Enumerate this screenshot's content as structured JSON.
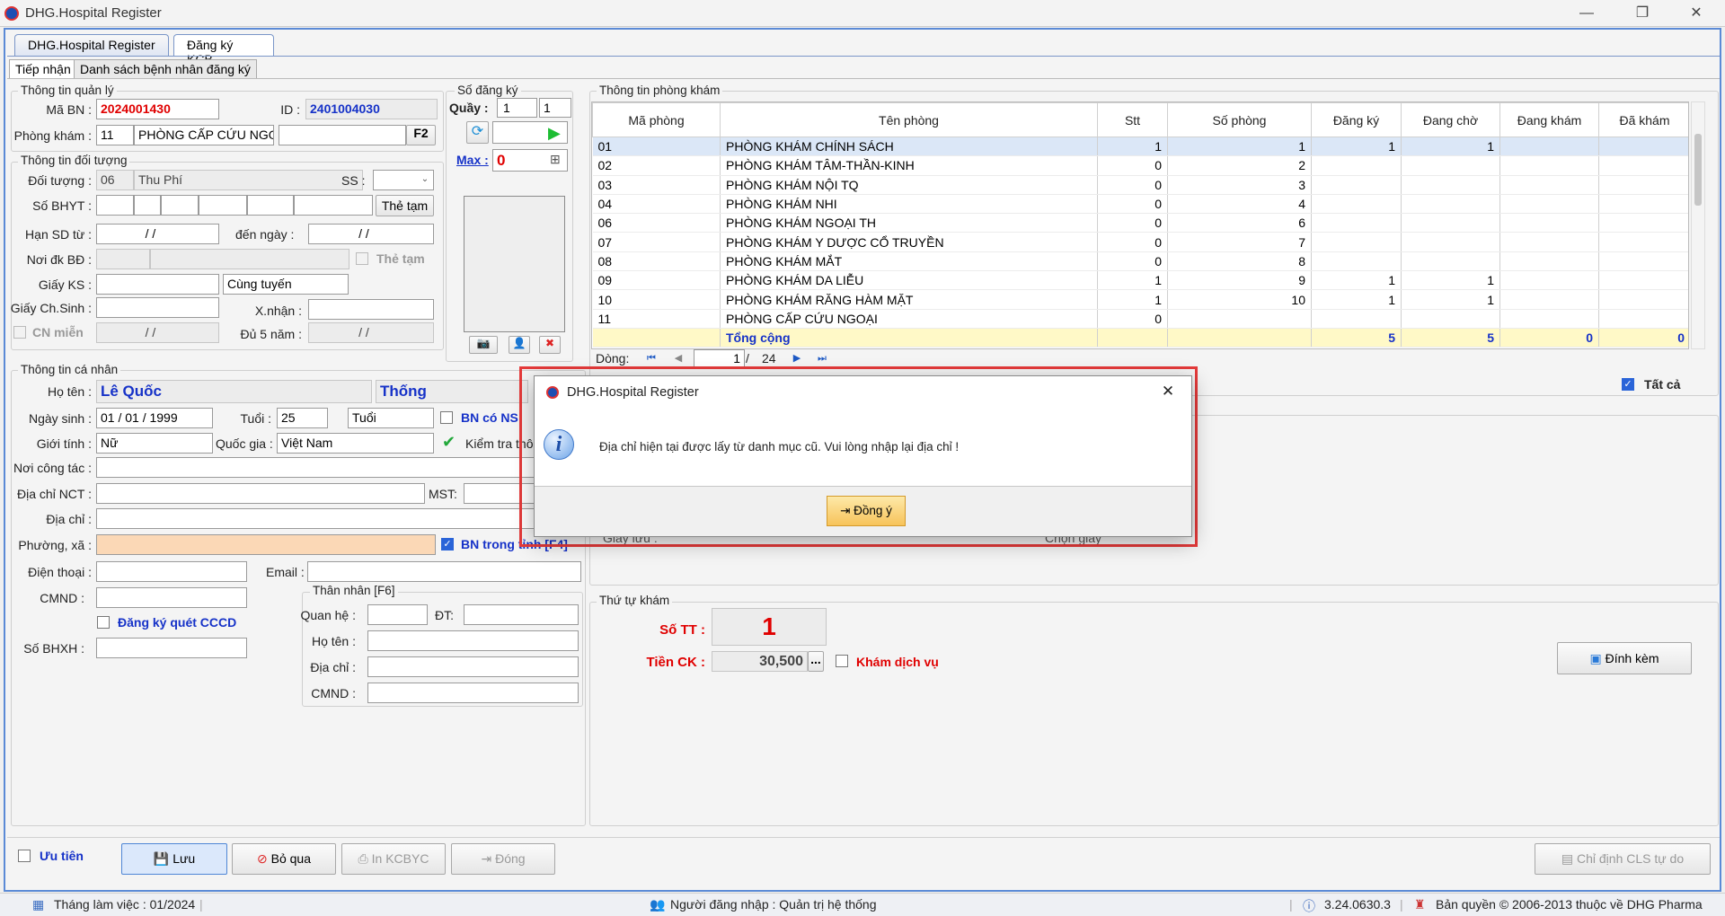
{
  "window": {
    "title": "DHG.Hospital Register",
    "min": "—",
    "max": "❐",
    "close": "✕"
  },
  "tabs_top": [
    "DHG.Hospital Register",
    "Đăng ký KCB"
  ],
  "tabs_sub": [
    "Tiếp nhận",
    "Danh sách bệnh nhân đăng ký"
  ],
  "quan_ly": {
    "title": "Thông tin quản lý",
    "ma_bn_label": "Mã BN :",
    "ma_bn": "2024001430",
    "id_label": "ID :",
    "id": "2401004030",
    "phong_kham_label": "Phòng khám :",
    "phong_kham_ma": "11",
    "phong_kham_ten": "PHÒNG CẤP CỨU NGOẠI",
    "f2": "F2"
  },
  "doi_tuong": {
    "title": "Thông tin đối tượng",
    "doi_tuong_label": "Đối tượng :",
    "doi_tuong_ma": "06",
    "doi_tuong_ten": "Thu Phí",
    "ss_label": "SS :",
    "so_bhyt_label": "Số BHYT :",
    "the_tam_btn": "Thẻ tạm",
    "han_sd_label": "Hạn SD từ :",
    "han_sd_from": "/ /",
    "den_ngay_label": "đến ngày :",
    "han_sd_to": "/ /",
    "noi_dk_label": "Nơi đk BĐ :",
    "the_tam_chk": "Thẻ tạm",
    "giay_ks_label": "Giấy KS :",
    "cung_tuyen": "Cùng tuyến",
    "giay_cs_label": "Giấy Ch.Sinh :",
    "xnhan_label": "X.nhận :",
    "cn_mien_label": "CN miễn",
    "cn_mien_date": "/ /",
    "du5_label": "Đủ 5 năm :",
    "du5_date": "/ /"
  },
  "so_dang_ky": {
    "title": "Số đăng ký",
    "quay_label": "Quầy :",
    "quay1": "1",
    "quay2": "1",
    "max_label": "Max :",
    "max_value": "0"
  },
  "ca_nhan": {
    "title": "Thông tin cá nhân",
    "ho_ten_label": "Họ tên :",
    "ho": "Lê Quốc",
    "ten": "Thống",
    "ngay_sinh_label": "Ngày sinh :",
    "ngay_sinh": "01 / 01 / 1999",
    "tuoi_label": "Tuổi :",
    "tuoi": "25",
    "tuoi_unit": "Tuổi",
    "bn_co_ns": "BN có NS",
    "gioi_tinh_label": "Giới tính :",
    "gioi_tinh": "Nữ",
    "quoc_gia_label": "Quốc gia :",
    "quoc_gia": "Việt Nam",
    "kiem_tra": "Kiểm tra thông",
    "noi_cong_tac_label": "Nơi công tác :",
    "dia_chi_nct_label": "Địa chỉ NCT :",
    "mst_label": "MST:",
    "dia_chi_label": "Địa chỉ :",
    "phuong_xa_label": "Phường, xã :",
    "bn_trong_tinh": "BN trong tỉnh [F4]",
    "dien_thoai_label": "Điện thoại :",
    "email_label": "Email :",
    "cmnd_label": "CMND :",
    "dk_quet_cccd": "Đăng ký quét CCCD",
    "so_bhxh_label": "Số BHXH :"
  },
  "than_nhan": {
    "title": "Thân nhân [F6]",
    "quan_he_label": "Quan hệ :",
    "dt_label": "ĐT:",
    "ho_ten_label": "Họ tên :",
    "dia_chi_label": "Địa chỉ :",
    "cmnd_label": "CMND :"
  },
  "phong_kham": {
    "title": "Thông tin phòng khám",
    "columns": [
      "Mã phòng",
      "Tên phòng",
      "Stt",
      "Số phòng",
      "Đăng ký",
      "Đang chờ",
      "Đang khám",
      "Đã khám"
    ],
    "rows": [
      [
        "01",
        "PHÒNG KHÁM CHÍNH SÁCH",
        "1",
        "1",
        "1",
        "1",
        "",
        ""
      ],
      [
        "02",
        "PHÒNG KHÁM TÂM-THẦN-KINH",
        "0",
        "2",
        "",
        "",
        "",
        ""
      ],
      [
        "03",
        "PHÒNG KHÁM NỘI TQ",
        "0",
        "3",
        "",
        "",
        "",
        ""
      ],
      [
        "04",
        "PHÒNG KHÁM NHI",
        "0",
        "4",
        "",
        "",
        "",
        ""
      ],
      [
        "06",
        "PHÒNG KHÁM NGOẠI TH",
        "0",
        "6",
        "",
        "",
        "",
        ""
      ],
      [
        "07",
        "PHÒNG KHÁM Y DƯỢC CỔ TRUYỀN",
        "0",
        "7",
        "",
        "",
        "",
        ""
      ],
      [
        "08",
        "PHÒNG KHÁM MẮT",
        "0",
        "8",
        "",
        "",
        "",
        ""
      ],
      [
        "09",
        "PHÒNG KHÁM DA LIỄU",
        "1",
        "9",
        "1",
        "1",
        "",
        ""
      ],
      [
        "10",
        "PHÒNG KHÁM RĂNG HÀM MẶT",
        "1",
        "10",
        "1",
        "1",
        "",
        ""
      ],
      [
        "11",
        "PHÒNG CẤP CỨU NGOẠI",
        "0",
        "",
        "",
        "",
        "",
        ""
      ]
    ],
    "total": [
      "",
      "Tổng cộng",
      "",
      "",
      "5",
      "5",
      "0",
      "0"
    ],
    "dong_label": "Dòng:",
    "page": "1",
    "pages": "24",
    "tat_ca": "Tất cả"
  },
  "behind": {
    "giay_luu": "Giấy lưu :",
    "chon_giay": "Chọn giấy"
  },
  "thu_tu": {
    "title": "Thứ tự khám",
    "so_tt_label": "Số TT :",
    "so_tt": "1",
    "tien_ck_label": "Tiền CK :",
    "tien_ck": "30,500",
    "kham_dv": "Khám dịch vụ",
    "dinh_kem": "Đính kèm"
  },
  "bottom": {
    "uu_tien": "Ưu tiên",
    "luu": "Lưu",
    "bo_qua": "Bỏ qua",
    "in_kcbyc": "In KCBYC",
    "dong": "Đóng",
    "chi_dinh": "Chỉ định CLS tự do"
  },
  "status": {
    "thang": "Tháng làm việc : 01/2024",
    "nguoi": "Người đăng nhập : Quản trị hệ thống",
    "version": "3.24.0630.3",
    "copyright": "Bản quyền © 2006-2013 thuộc về DHG Pharma"
  },
  "dialog": {
    "title": "DHG.Hospital Register",
    "message": "Địa chỉ hiện tại được lấy từ danh mục cũ. Vui lòng nhập lại địa chỉ !",
    "ok": "Đồng ý",
    "close": "✕"
  },
  "colors": {
    "accent": "#1632c8",
    "error": "#e00000",
    "highlight": "#e53a3a"
  }
}
